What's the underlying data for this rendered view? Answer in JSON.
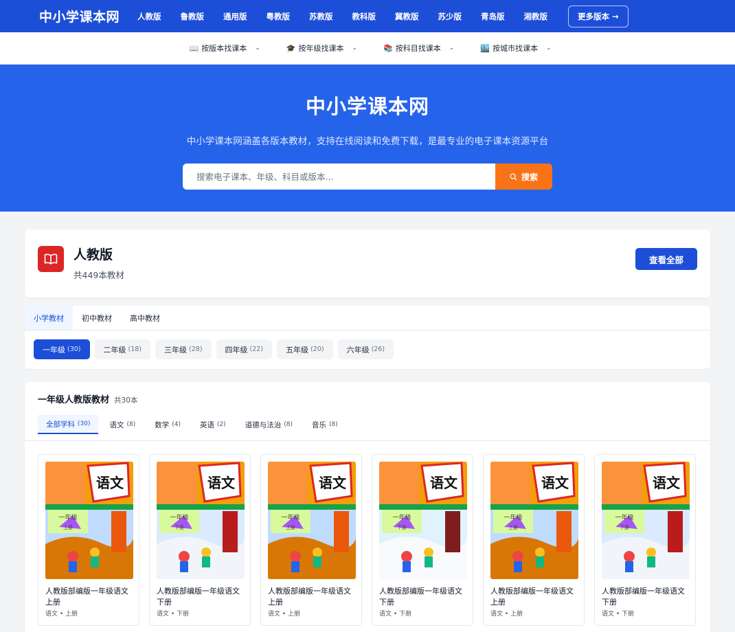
{
  "site": {
    "logo": "中小学课本网",
    "nav": [
      "人教版",
      "鲁教版",
      "通用版",
      "粤教版",
      "苏教版",
      "教科版",
      "冀教版",
      "苏少版",
      "青岛版",
      "湘教版"
    ],
    "more": "更多版本 →"
  },
  "subnav": [
    {
      "emoji": "📖",
      "label": "按版本找课本"
    },
    {
      "emoji": "🎓",
      "label": "按年级找课本"
    },
    {
      "emoji": "📚",
      "label": "按科目找课本"
    },
    {
      "emoji": "🏙️",
      "label": "按城市找课本"
    }
  ],
  "hero": {
    "title": "中小学课本网",
    "subtitle": "中小学课本网涵盖各版本教材，支持在线阅读和免费下载，是最专业的电子课本资源平台",
    "search_placeholder": "搜索电子课本、年级、科目或版本...",
    "search_button": "搜索"
  },
  "publisher": {
    "name": "人教版",
    "count": "共449本教材",
    "view_all": "查看全部",
    "icon": "book-open-icon",
    "icon_color": "#dc2626"
  },
  "levels": [
    "小学教材",
    "初中教材",
    "高中教材"
  ],
  "grades": [
    {
      "label": "一年级",
      "count": "(30)"
    },
    {
      "label": "二年级",
      "count": "(18)"
    },
    {
      "label": "三年级",
      "count": "(28)"
    },
    {
      "label": "四年级",
      "count": "(22)"
    },
    {
      "label": "五年级",
      "count": "(20)"
    },
    {
      "label": "六年级",
      "count": "(26)"
    }
  ],
  "books_section": {
    "title": "一年级人教版教材",
    "total": "共30本",
    "subjects": [
      {
        "label": "全部学科",
        "count": "(30)"
      },
      {
        "label": "语文",
        "count": "(8)"
      },
      {
        "label": "数学",
        "count": "(4)"
      },
      {
        "label": "英语",
        "count": "(2)"
      },
      {
        "label": "道德与法治",
        "count": "(8)"
      },
      {
        "label": "音乐",
        "count": "(8)"
      }
    ],
    "books": [
      {
        "title": "人教版部编版一年级语文上册",
        "meta": "语文 • 上册",
        "cover_word": "语文",
        "cover_grade": "一年级",
        "cover_vol": "上册",
        "scene": "autumn"
      },
      {
        "title": "人教版部编版一年级语文下册",
        "meta": "语文 • 下册",
        "cover_word": "语文",
        "cover_grade": "一年级",
        "cover_vol": "下册",
        "scene": "spring"
      },
      {
        "title": "人教版部编版一年级语文上册",
        "meta": "语文 • 上册",
        "cover_word": "语文",
        "cover_grade": "一年级",
        "cover_vol": "上册",
        "scene": "autumn"
      },
      {
        "title": "人教版部编版一年级语文下册",
        "meta": "语文 • 下册",
        "cover_word": "语文",
        "cover_grade": "一年级",
        "cover_vol": "下册",
        "scene": "winter"
      },
      {
        "title": "人教版部编版一年级语文上册",
        "meta": "语文 • 上册",
        "cover_word": "语文",
        "cover_grade": "一年级",
        "cover_vol": "上册",
        "scene": "autumn"
      },
      {
        "title": "人教版部编版一年级语文下册",
        "meta": "语文 • 下册",
        "cover_word": "语文",
        "cover_grade": "一年级",
        "cover_vol": "下册",
        "scene": "spring"
      }
    ]
  },
  "colors": {
    "primary": "#1d4ed8",
    "hero_bg": "#2563eb",
    "search_button": "#f97316"
  }
}
